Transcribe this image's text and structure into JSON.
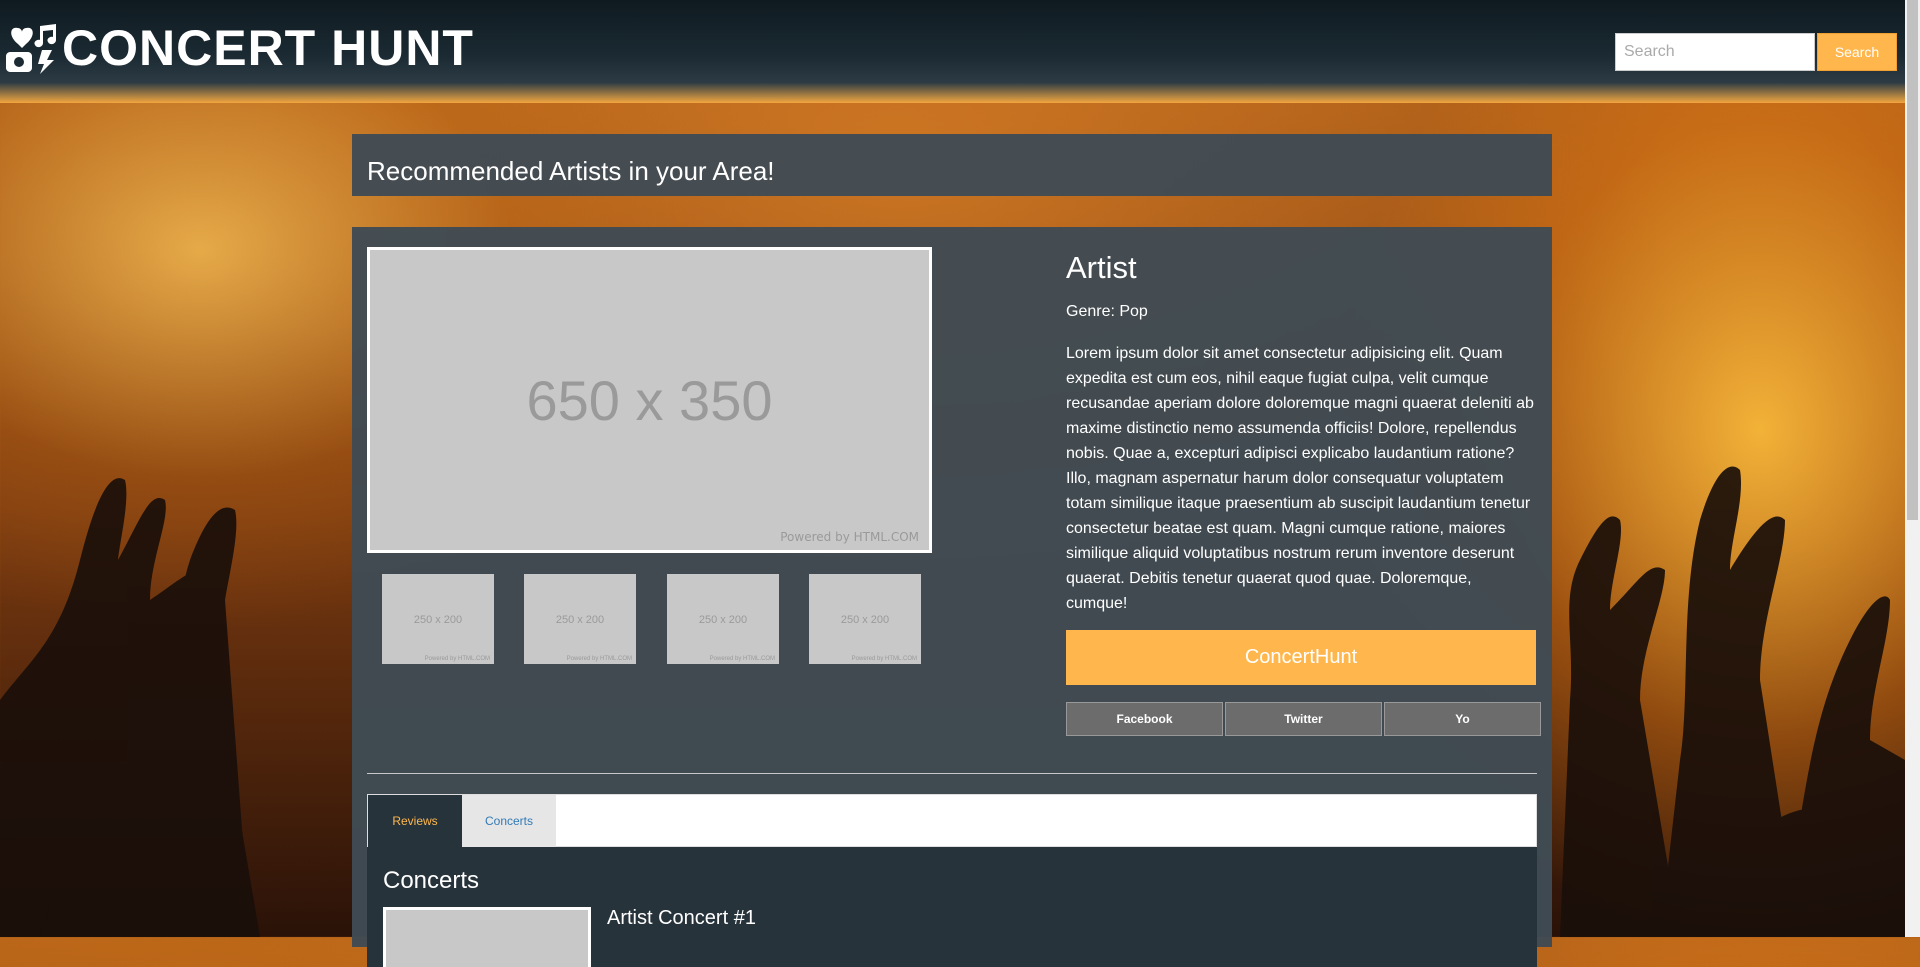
{
  "header": {
    "logo_text": "CONCERT HUNT",
    "logo_icon": "music-heart-icon",
    "search_placeholder": "Search",
    "search_button": "Search"
  },
  "section_title": "Recommended Artists in your Area!",
  "gallery": {
    "main_image_label": "650 x 350",
    "main_image_credit": "Powered by HTML.COM",
    "thumbnails": [
      {
        "label": "250 x 200",
        "credit": "Powered by HTML.COM"
      },
      {
        "label": "250 x 200",
        "credit": "Powered by HTML.COM"
      },
      {
        "label": "250 x 200",
        "credit": "Powered by HTML.COM"
      },
      {
        "label": "250 x 200",
        "credit": "Powered by HTML.COM"
      }
    ]
  },
  "artist": {
    "name": "Artist",
    "genre": "Genre: Pop",
    "description": "Lorem ipsum dolor sit amet consectetur adipisicing elit. Quam expedita est cum eos, nihil eaque fugiat culpa, velit cumque recusandae aperiam dolore doloremque magni quaerat deleniti ab maxime distinctio nemo assumenda officiis! Dolore, repellendus nobis. Quae a, excepturi adipisci explicabo laudantium ratione? Illo, magnam aspernatur harum dolor consequatur voluptatem totam similique itaque praesentium ab suscipit laudantium tenetur consectetur beatae est quam. Magni cumque ratione, maiores similique aliquid voluptatibus nostrum rerum inventore deserunt quaerat. Debitis tenetur quaerat quod quae. Doloremque, cumque!",
    "cta_label": "ConcertHunt",
    "social": [
      "Facebook",
      "Twitter",
      "Yo"
    ]
  },
  "tabs": {
    "items": [
      "Reviews",
      "Concerts"
    ],
    "active": "Reviews"
  },
  "concerts": {
    "heading": "Concerts",
    "first_title": "Artist Concert #1"
  },
  "colors": {
    "accent": "#ffb74d",
    "panel": "#404b54",
    "header_dark": "#1b2a33"
  }
}
